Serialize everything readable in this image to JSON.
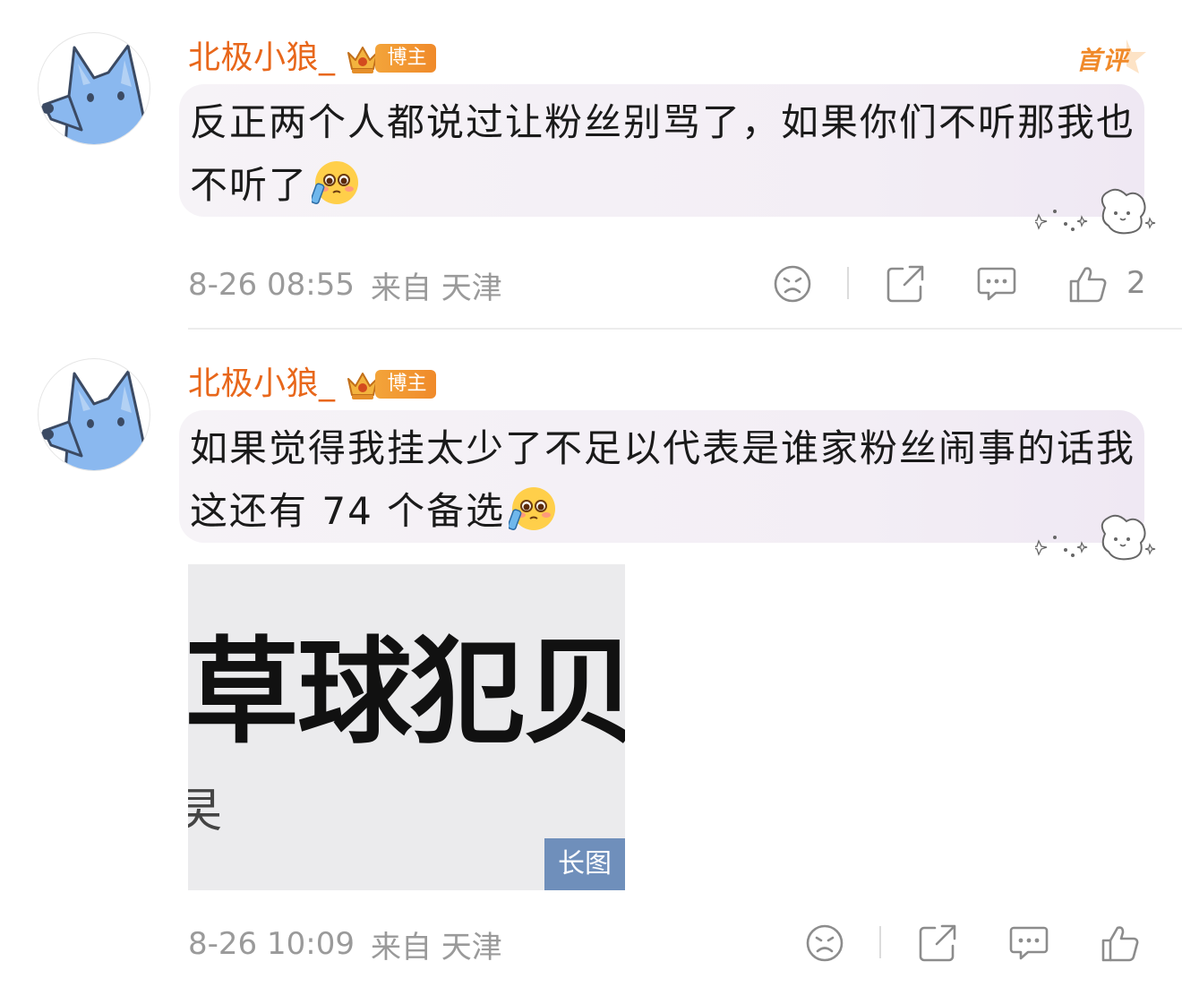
{
  "colors": {
    "username": "#e8671b",
    "badge": "#f08a2a",
    "meta": "#9a9a9a",
    "long_tag_bg": "#6f8fbb"
  },
  "comments": [
    {
      "username": "北极小狼_",
      "badge_label": "博主",
      "first_tag": "首评",
      "text": "反正两个人都说过让粉丝别骂了，如果你们不听那我也不听了",
      "emoji": "crying-pleading-emoji",
      "timestamp": "8-26 08:55",
      "location": "来自 天津",
      "like_count": "2"
    },
    {
      "username": "北极小狼_",
      "badge_label": "博主",
      "text": "如果觉得我挂太少了不足以代表是谁家粉丝闹事的话我这还有 74 个备选",
      "emoji": "crying-pleading-emoji",
      "image_text_big": "草球犯贝",
      "image_text_small": "旲",
      "image_tag": "长图",
      "timestamp": "8-26 10:09",
      "location": "来自 天津"
    }
  ]
}
